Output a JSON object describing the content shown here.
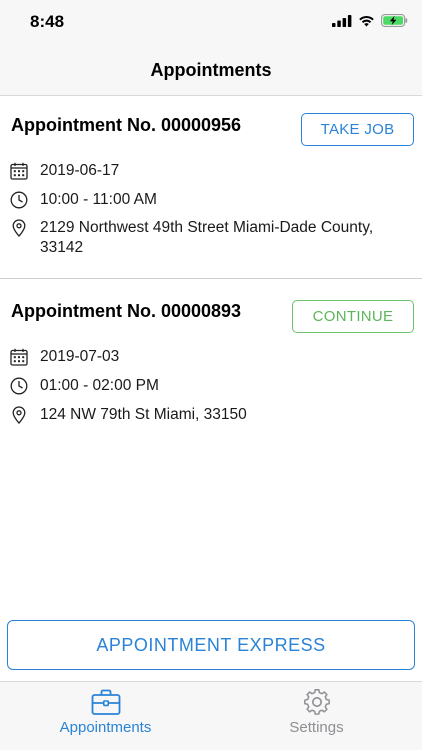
{
  "status_bar": {
    "time": "8:48",
    "icons": [
      "signal-icon",
      "wifi-icon",
      "battery-charging-icon"
    ]
  },
  "nav": {
    "title": "Appointments"
  },
  "appointments": [
    {
      "title": "Appointment No. 00000956",
      "action_label": "TAKE JOB",
      "action_color": "#2a83d6",
      "date": "2019-06-17",
      "time": "10:00 - 11:00 AM",
      "address": "2129 Northwest 49th Street Miami-Dade County, 33142"
    },
    {
      "title": "Appointment No. 00000893",
      "action_label": "CONTINUE",
      "action_color": "#5bb55a",
      "date": "2019-07-03",
      "time": "01:00 - 02:00 PM",
      "address": "124 NW 79th St Miami,  33150"
    }
  ],
  "express_button": {
    "label": "APPOINTMENT EXPRESS"
  },
  "tab_bar": {
    "tabs": [
      {
        "label": "Appointments",
        "icon": "briefcase-icon",
        "active": true
      },
      {
        "label": "Settings",
        "icon": "gear-icon",
        "active": false
      }
    ]
  },
  "colors": {
    "accent": "#2a83d6",
    "success": "#5bb55a",
    "inactive": "#8e8e93"
  }
}
